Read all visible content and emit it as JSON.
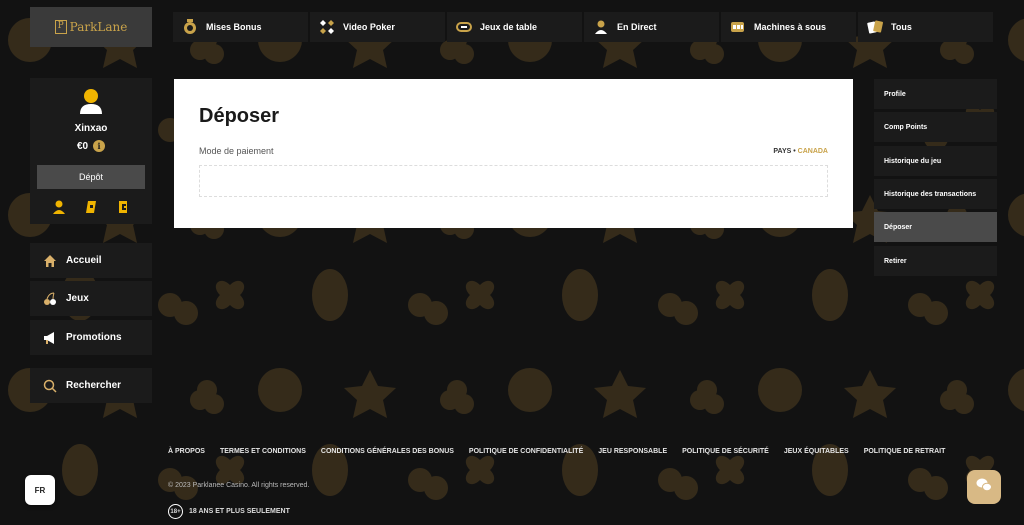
{
  "brand": {
    "logo_text": "ParkLane",
    "logo_mark": "P",
    "accent": "#c9a34a"
  },
  "topnav": [
    {
      "label": "Mises Bonus",
      "icon": "medal-icon"
    },
    {
      "label": "Video Poker",
      "icon": "card-suits-icon"
    },
    {
      "label": "Jeux de table",
      "icon": "table-icon"
    },
    {
      "label": "En Direct",
      "icon": "dealer-icon"
    },
    {
      "label": "Machines à sous",
      "icon": "slot-machine-icon"
    },
    {
      "label": "Tous",
      "icon": "cards-icon"
    }
  ],
  "user": {
    "name": "Xinxao",
    "balance": "€0",
    "info_glyph": "i",
    "deposit_label": "Dépôt",
    "quick_icons": [
      "profile-icon",
      "ticket-icon",
      "comp-points-icon"
    ]
  },
  "sidemenu": [
    {
      "label": "Accueil",
      "icon": "home-icon"
    },
    {
      "label": "Jeux",
      "icon": "cherries-icon"
    },
    {
      "label": "Promotions",
      "icon": "megaphone-icon"
    },
    {
      "label": "Rechercher",
      "icon": "search-icon"
    }
  ],
  "panel": {
    "title": "Déposer",
    "payment_label": "Mode de paiement",
    "country_label": "PAYS",
    "country_sep": " • ",
    "country_value": "CANADA"
  },
  "rightmenu": [
    {
      "label": "Profile",
      "active": false
    },
    {
      "label": "Comp Points",
      "active": false
    },
    {
      "label": "Historique du jeu",
      "active": false
    },
    {
      "label": "Historique des transactions",
      "active": false
    },
    {
      "label": "Déposer",
      "active": true
    },
    {
      "label": "Retirer",
      "active": false
    }
  ],
  "footer": {
    "links": [
      "À PROPOS",
      "TERMES ET CONDITIONS",
      "CONDITIONS GÉNÉRALES DES BONUS",
      "POLITIQUE DE CONFIDENTIALITÉ",
      "JEU RESPONSABLE",
      "POLITIQUE DE SÉCURITÉ",
      "JEUX ÉQUITABLES",
      "POLITIQUE DE RETRAIT"
    ],
    "copyright": "© 2023 Parklanee Casino. All rights reserved.",
    "age_badge": "18+",
    "age_text": "18 ANS ET PLUS SEULEMENT"
  },
  "language": "FR",
  "chat_icon": "chat-icon"
}
